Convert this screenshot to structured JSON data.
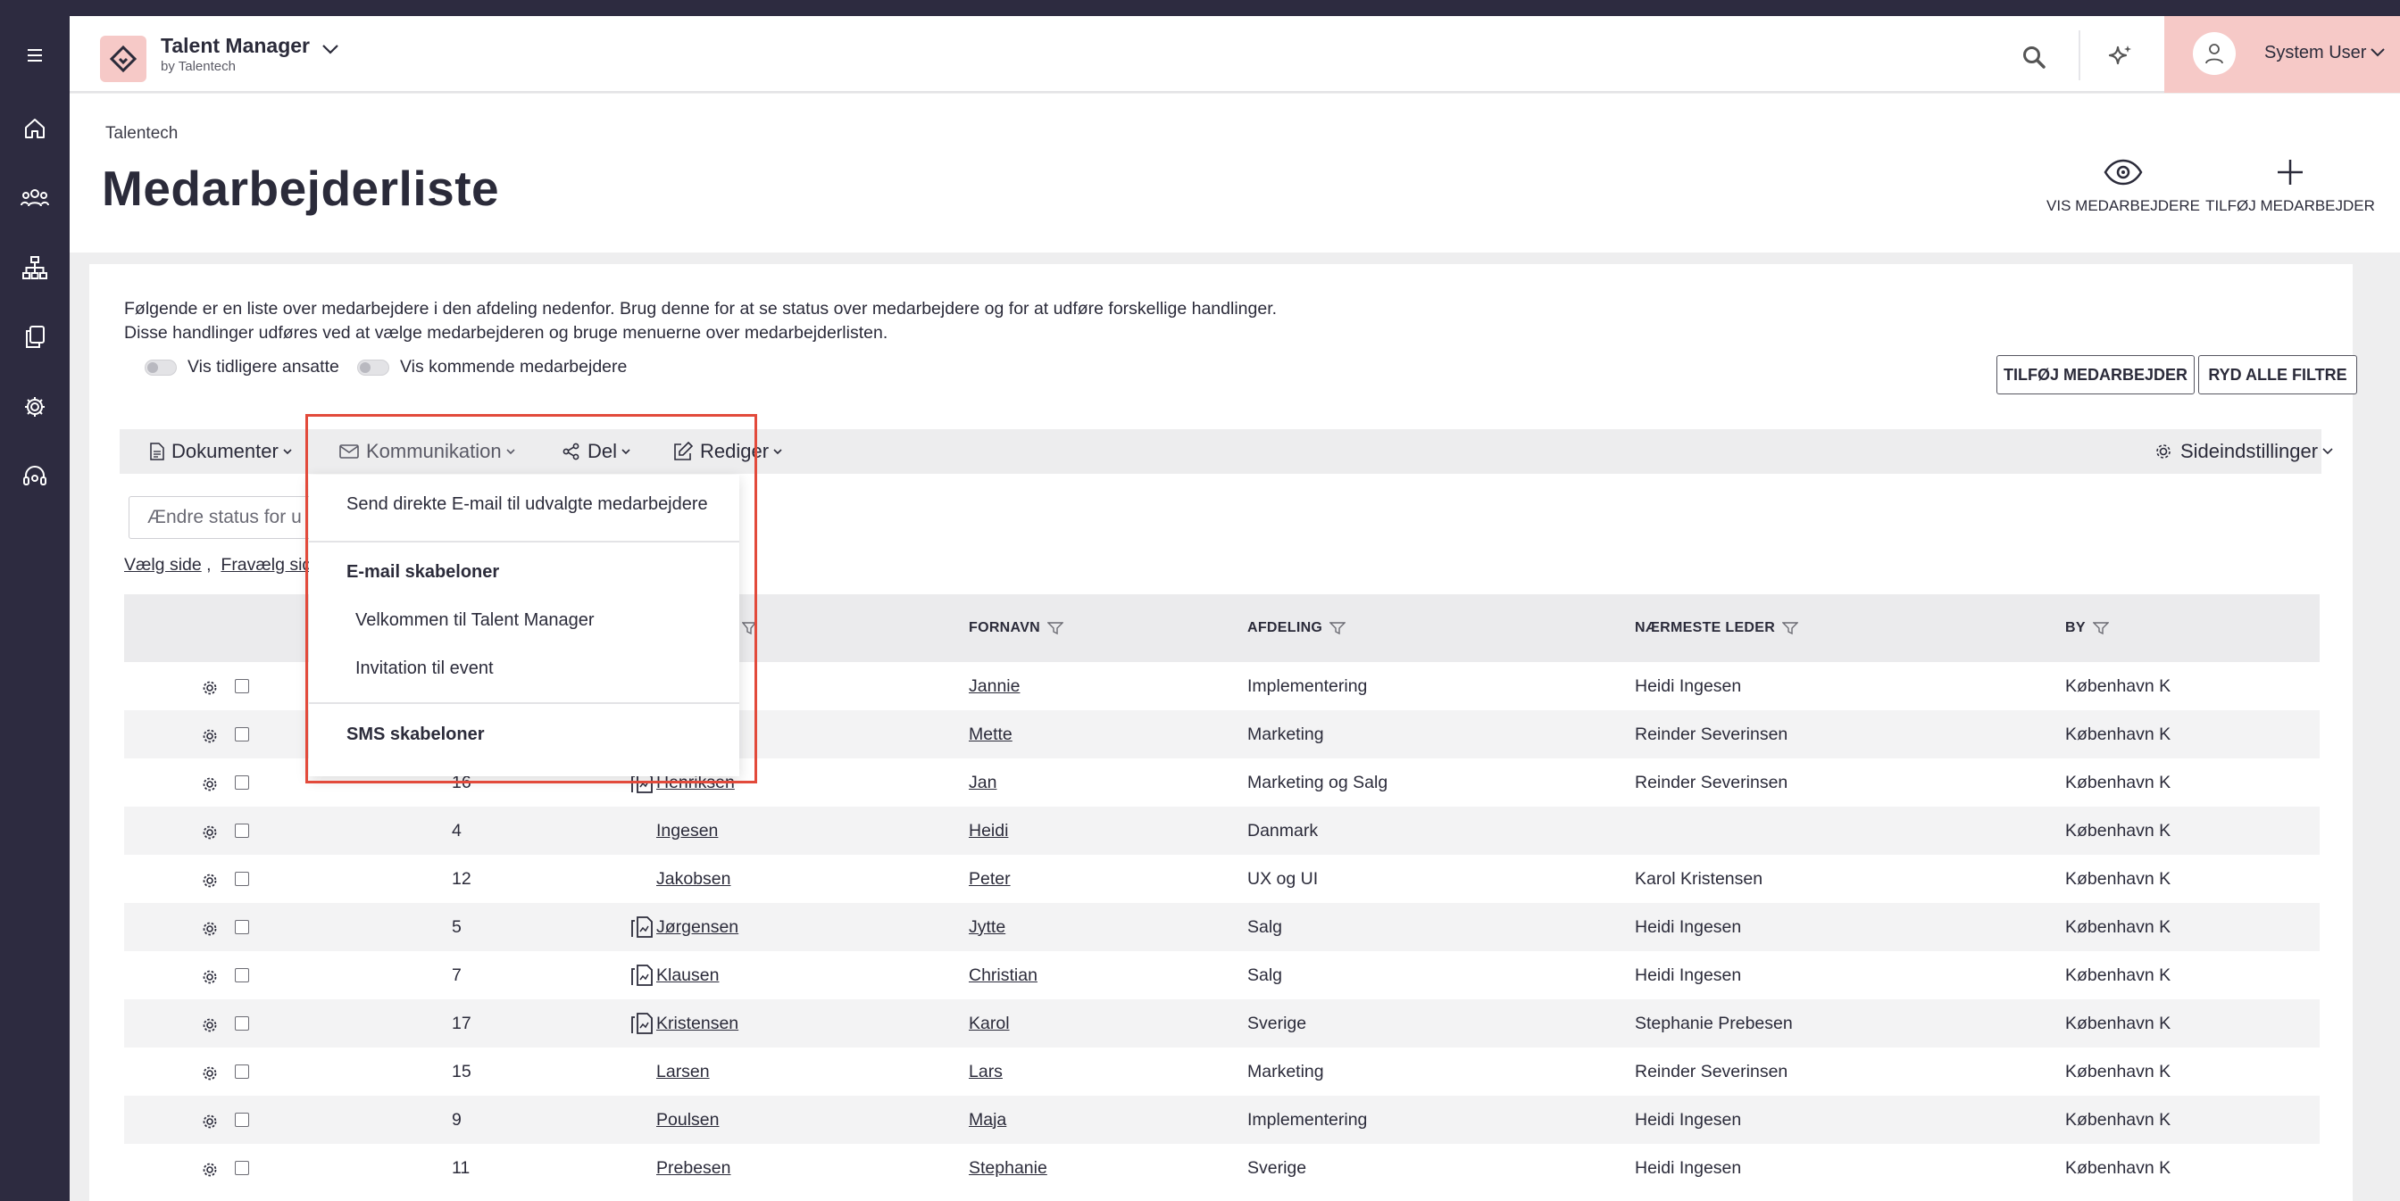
{
  "app": {
    "title": "Talent Manager",
    "subtitle": "by Talentech"
  },
  "user": {
    "name": "System User"
  },
  "header": {
    "breadcrumb": "Talentech",
    "title": "Medarbejderliste",
    "actions": {
      "view": "VIS MEDARBEJDERE",
      "add": "TILFØJ MEDARBEJDER"
    }
  },
  "intro": {
    "line1": "Følgende er en liste over medarbejdere i den afdeling nedenfor. Brug denne for at se status over medarbejdere og for at udføre forskellige handlinger.",
    "line2": "Disse handlinger udføres ved at vælge medarbejderen og bruge menuerne over medarbejderlisten."
  },
  "toggles": {
    "former": "Vis tidligere ansatte",
    "upcoming": "Vis kommende medarbejdere"
  },
  "buttons": {
    "add_employee": "TILFØJ MEDARBEJDER",
    "clear_filters": "RYD ALLE FILTRE"
  },
  "toolbar": {
    "documents": "Dokumenter",
    "communication": "Kommunikation",
    "share": "Del",
    "edit": "Rediger",
    "page_settings": "Sideindstillinger"
  },
  "status_input": {
    "placeholder": "Ændre status for u"
  },
  "select_links": {
    "select_page": "Vælg side",
    "separator": " ,",
    "deselect_page": "Fravælg side"
  },
  "table": {
    "headers": {
      "first_name": "FORNAVN",
      "department": "AFDELING",
      "manager": "NÆRMESTE LEDER",
      "city": "BY"
    },
    "rows": [
      {
        "id": "",
        "has_doc": false,
        "last_name": "",
        "first_name": "Jannie",
        "department": "Implementering",
        "manager": "Heidi Ingesen",
        "city": "København K"
      },
      {
        "id": "",
        "has_doc": false,
        "last_name": "",
        "first_name": "Mette",
        "department": "Marketing",
        "manager": "Reinder Severinsen",
        "city": "København K"
      },
      {
        "id": "16",
        "has_doc": true,
        "last_name": "Henriksen",
        "first_name": "Jan",
        "department": "Marketing og Salg",
        "manager": "Reinder Severinsen",
        "city": "København K"
      },
      {
        "id": "4",
        "has_doc": false,
        "last_name": "Ingesen",
        "first_name": "Heidi",
        "department": "Danmark",
        "manager": "",
        "city": "København K"
      },
      {
        "id": "12",
        "has_doc": false,
        "last_name": "Jakobsen",
        "first_name": "Peter",
        "department": "UX og UI",
        "manager": "Karol Kristensen",
        "city": "København K"
      },
      {
        "id": "5",
        "has_doc": true,
        "last_name": "Jørgensen",
        "first_name": "Jytte",
        "department": "Salg",
        "manager": "Heidi Ingesen",
        "city": "København K"
      },
      {
        "id": "7",
        "has_doc": true,
        "last_name": "Klausen",
        "first_name": "Christian",
        "department": "Salg",
        "manager": "Heidi Ingesen",
        "city": "København K"
      },
      {
        "id": "17",
        "has_doc": true,
        "last_name": "Kristensen",
        "first_name": "Karol",
        "department": "Sverige",
        "manager": "Stephanie Prebesen",
        "city": "København K"
      },
      {
        "id": "15",
        "has_doc": false,
        "last_name": "Larsen",
        "first_name": "Lars",
        "department": "Marketing",
        "manager": "Reinder Severinsen",
        "city": "København K"
      },
      {
        "id": "9",
        "has_doc": false,
        "last_name": "Poulsen",
        "first_name": "Maja",
        "department": "Implementering",
        "manager": "Heidi Ingesen",
        "city": "København K"
      },
      {
        "id": "11",
        "has_doc": false,
        "last_name": "Prebesen",
        "first_name": "Stephanie",
        "department": "Sverige",
        "manager": "Heidi Ingesen",
        "city": "København K"
      }
    ]
  },
  "dropdown": {
    "send_email": "Send direkte E-mail til udvalgte medarbejdere",
    "email_templates": "E-mail skabeloner",
    "email_items": [
      "Velkommen til Talent Manager",
      "Invitation til event"
    ],
    "sms_templates": "SMS skabeloner"
  },
  "colors": {
    "sidebar": "#2d2b40",
    "accent_pink": "#f6c9c7",
    "highlight": "#e24a3b"
  }
}
